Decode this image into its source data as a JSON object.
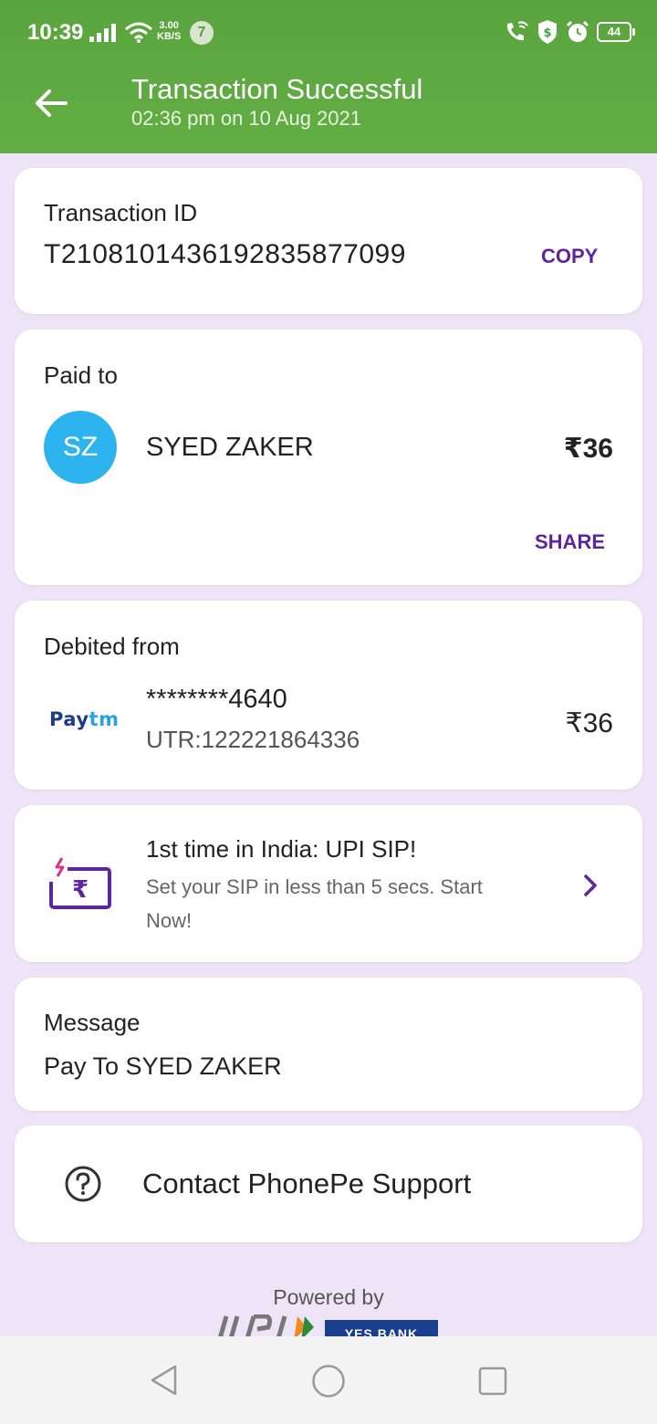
{
  "status_bar": {
    "time": "10:39",
    "net_speed_value": "3.00",
    "net_speed_unit": "KB/S",
    "notification_count": "7",
    "battery": "44"
  },
  "header": {
    "title": "Transaction Successful",
    "subtitle": "02:36 pm on 10 Aug 2021"
  },
  "transaction": {
    "label": "Transaction ID",
    "id": "T2108101436192835877099",
    "copy_label": "COPY"
  },
  "paid_to": {
    "label": "Paid to",
    "initials": "SZ",
    "name": "SYED ZAKER",
    "amount": "₹36",
    "share_label": "SHARE"
  },
  "debited_from": {
    "label": "Debited from",
    "account": "********4640",
    "utr": "UTR:122221864336",
    "amount": "₹36",
    "bank_logo_text_a": "Pay",
    "bank_logo_text_b": "tm"
  },
  "promo": {
    "title": "1st time in India: UPI SIP!",
    "description_line1": "Set your SIP in less than 5 secs. Start",
    "description_line2": "Now!"
  },
  "message": {
    "label": "Message",
    "text": "Pay To SYED ZAKER"
  },
  "support": {
    "label": "Contact PhonePe Support"
  },
  "footer": {
    "powered_by": "Powered by",
    "bank_text": "YES BANK"
  },
  "colors": {
    "header_green": "#5fab42",
    "accent_purple": "#5f259f",
    "background": "#ede5f7",
    "avatar_blue": "#2db4ee"
  }
}
